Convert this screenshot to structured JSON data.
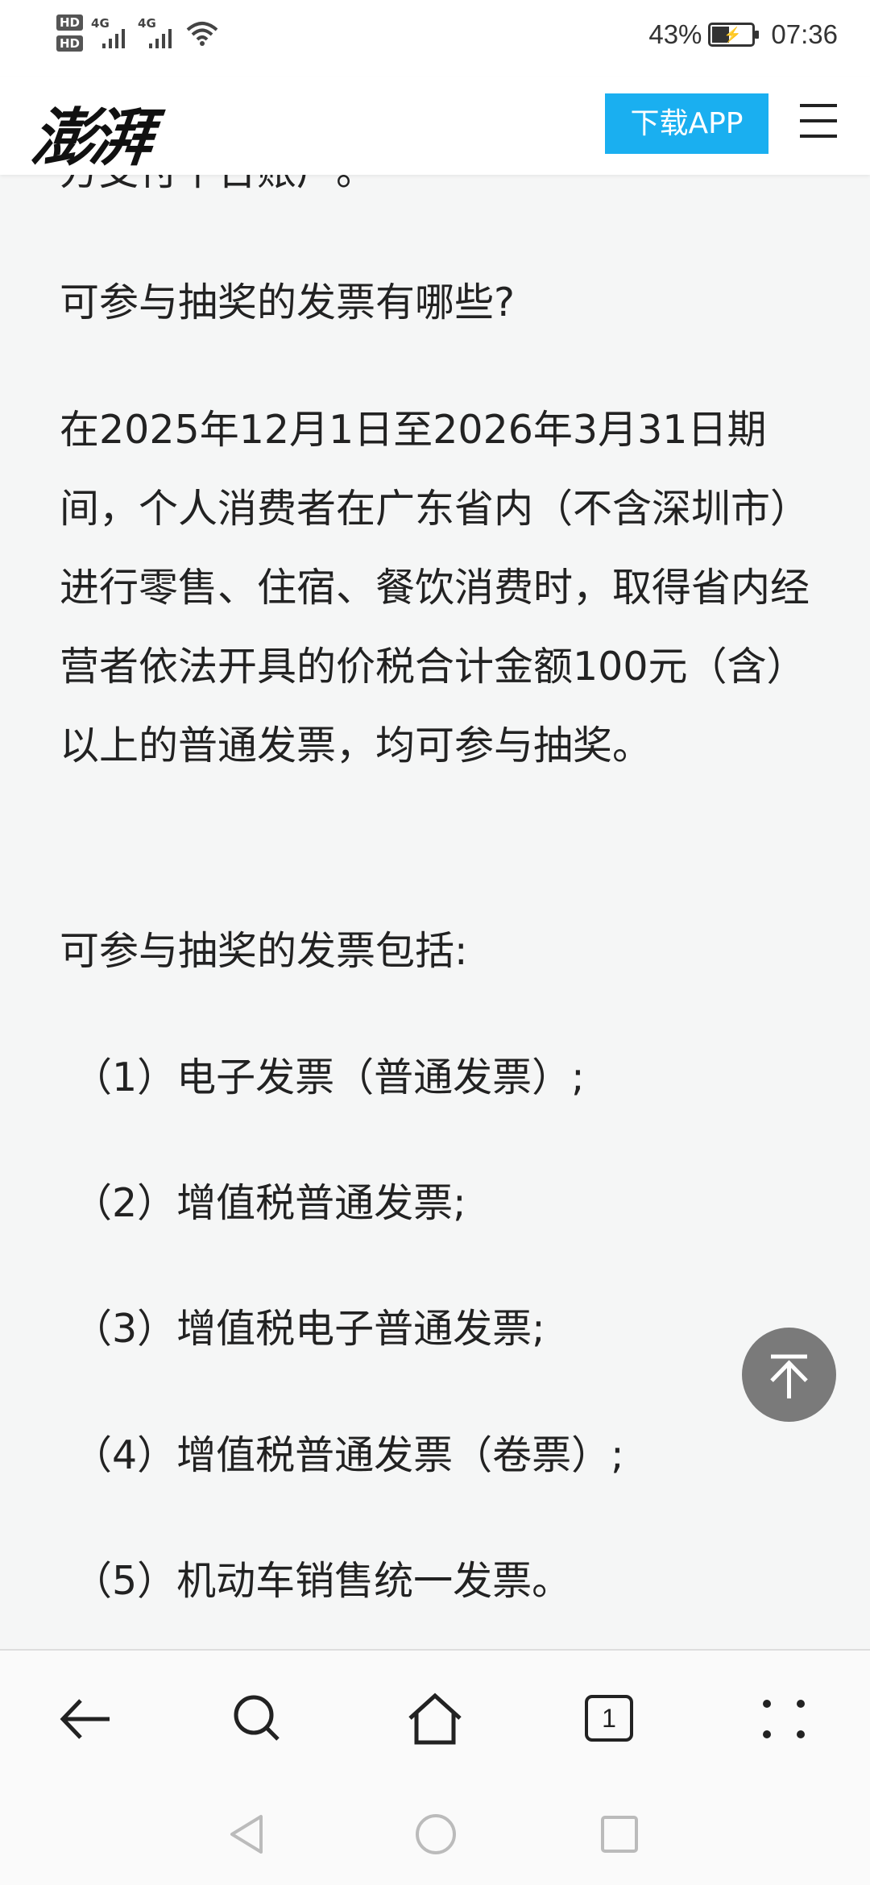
{
  "status_bar": {
    "sim1": "HD",
    "sim2": "HD",
    "net1": "4G",
    "net2": "4G",
    "battery_percent": "43%",
    "time": "07:36",
    "battery_level": 0.43
  },
  "header": {
    "logo": "澎湃",
    "download_label": "下载APP"
  },
  "article": {
    "cut_line": "方支付平台账户。",
    "question": "可参与抽奖的发票有哪些?",
    "body": "在2025年12月1日至2026年3月31日期间，个人消费者在广东省内（不含深圳市）进行零售、住宿、餐饮消费时，取得省内经营者依法开具的价税合计金额100元（含）以上的普通发票，均可参与抽奖。",
    "list_intro": "可参与抽奖的发票包括:",
    "list": [
      "（1）电子发票（普通发票）;",
      "（2）增值税普通发票;",
      "（3）增值税电子普通发票;",
      "（4）增值税普通发票（卷票）;",
      "（5）机动车销售统一发票。"
    ]
  },
  "toolbar": {
    "tab_count": "1"
  },
  "icons": {
    "back": "arrow-left-icon",
    "search": "search-icon",
    "home": "home-icon",
    "tabs": "tabs-icon",
    "more": "more-dots-icon",
    "back_to_top": "arrow-up-to-top-icon",
    "menu": "hamburger-menu-icon",
    "nav_back": "triangle-back-icon",
    "nav_home": "circle-home-icon",
    "nav_recent": "square-recent-icon"
  },
  "colors": {
    "accent": "#1aaff0",
    "background": "#f5f6f6",
    "back_to_top": "#7a7a7a"
  }
}
